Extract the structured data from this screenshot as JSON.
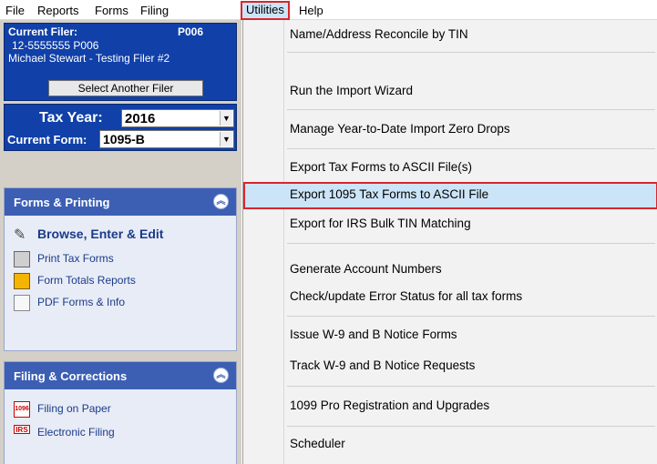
{
  "menubar": {
    "items": [
      "File",
      "Reports",
      "Forms",
      "Filing",
      "Utilities",
      "Help"
    ],
    "active": "Utilities"
  },
  "filer": {
    "heading": "Current Filer:",
    "code": "P006",
    "id_line": "12-5555555  P006",
    "name": "Michael Stewart - Testing Filer #2",
    "button": "Select Another Filer"
  },
  "tax": {
    "year_label": "Tax Year:",
    "year_value": "2016",
    "form_label": "Current Form:",
    "form_value": "1095-B"
  },
  "forms_printing": {
    "title": "Forms & Printing",
    "items": [
      "Browse, Enter & Edit",
      "Print Tax Forms",
      "Form Totals Reports",
      "PDF Forms & Info"
    ]
  },
  "filing_corrections": {
    "title": "Filing & Corrections",
    "items": [
      "Filing on Paper",
      "Electronic Filing"
    ]
  },
  "utilities_menu": {
    "items": [
      "Name/Address Reconcile by TIN",
      "Run the Import Wizard",
      "Manage Year-to-Date Import Zero Drops",
      "Export Tax Forms to ASCII File(s)",
      "Export 1095 Tax Forms to ASCII File",
      "Export for IRS Bulk TIN Matching",
      "Generate Account Numbers",
      "Check/update Error Status for all tax forms",
      "Issue W-9 and B Notice Forms",
      "Track W-9 and B Notice Requests",
      "1099 Pro Registration and Upgrades",
      "Scheduler"
    ],
    "highlighted": "Export 1095 Tax Forms to ASCII File"
  },
  "colors": {
    "panel_blue": "#1040a8",
    "section_header": "#3c5fb4",
    "highlight": "#cce4f7",
    "callout_red": "#d9262c"
  },
  "icons": {
    "browse": "quill-icon",
    "print": "printer-icon",
    "totals": "report-icon",
    "pdf": "pdf-icon",
    "paper": "form-1096-icon",
    "efile": "irs-icon",
    "collapse": "chevron-up-icon"
  }
}
